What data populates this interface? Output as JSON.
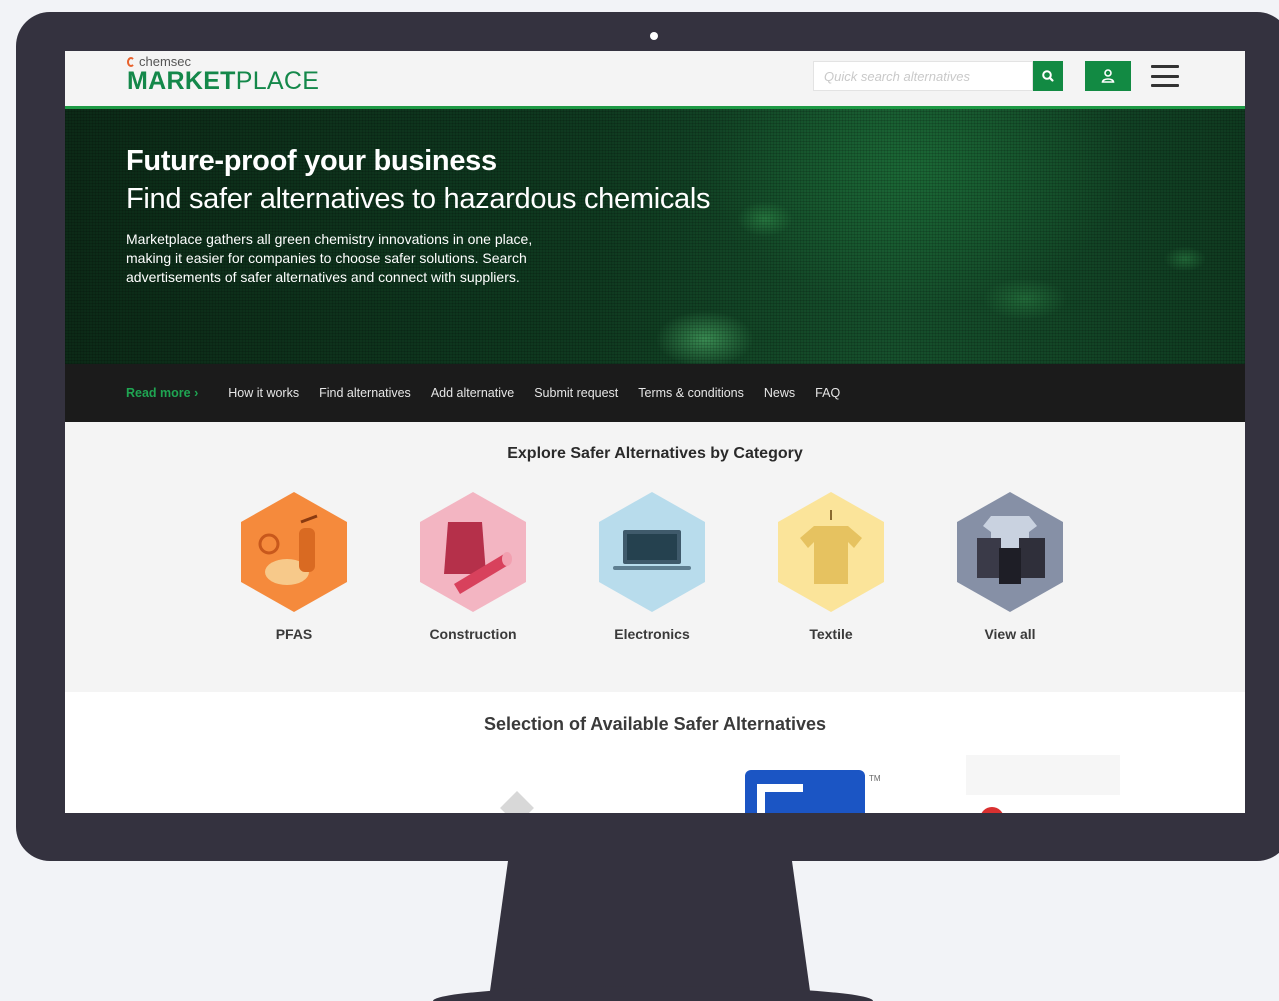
{
  "header": {
    "logo_top": "chemsec",
    "logo_bold": "MARKET",
    "logo_light": "PLACE",
    "search_placeholder": "Quick search alternatives"
  },
  "hero": {
    "title": "Future-proof your business",
    "subtitle": "Find safer alternatives to hazardous chemicals",
    "text": "Marketplace gathers all green chemistry innovations in one place, making it easier for companies to choose safer solutions. Search advertisements of safer alternatives and connect with suppliers."
  },
  "nav": {
    "read_more": "Read more ›",
    "items": [
      "How it works",
      "Find alternatives",
      "Add alternative",
      "Submit request",
      "Terms & conditions",
      "News",
      "FAQ"
    ]
  },
  "categories": {
    "title": "Explore Safer Alternatives by Category",
    "items": [
      {
        "label": "PFAS",
        "color": "#f58a3c",
        "icon": "extinguisher-pan-icon"
      },
      {
        "label": "Construction",
        "color": "#f3b5c2",
        "icon": "bag-pipe-icon"
      },
      {
        "label": "Electronics",
        "color": "#b8dcec",
        "icon": "laptop-icon"
      },
      {
        "label": "Textile",
        "color": "#fbe49a",
        "icon": "shirt-icon"
      },
      {
        "label": "View all",
        "color": "#8690a6",
        "icon": "mixed-products-icon"
      }
    ]
  },
  "selection": {
    "title": "Selection of Available Safer Alternatives",
    "tm": "TM"
  },
  "colors": {
    "brand_green": "#128a43",
    "monitor": "#34323f"
  }
}
